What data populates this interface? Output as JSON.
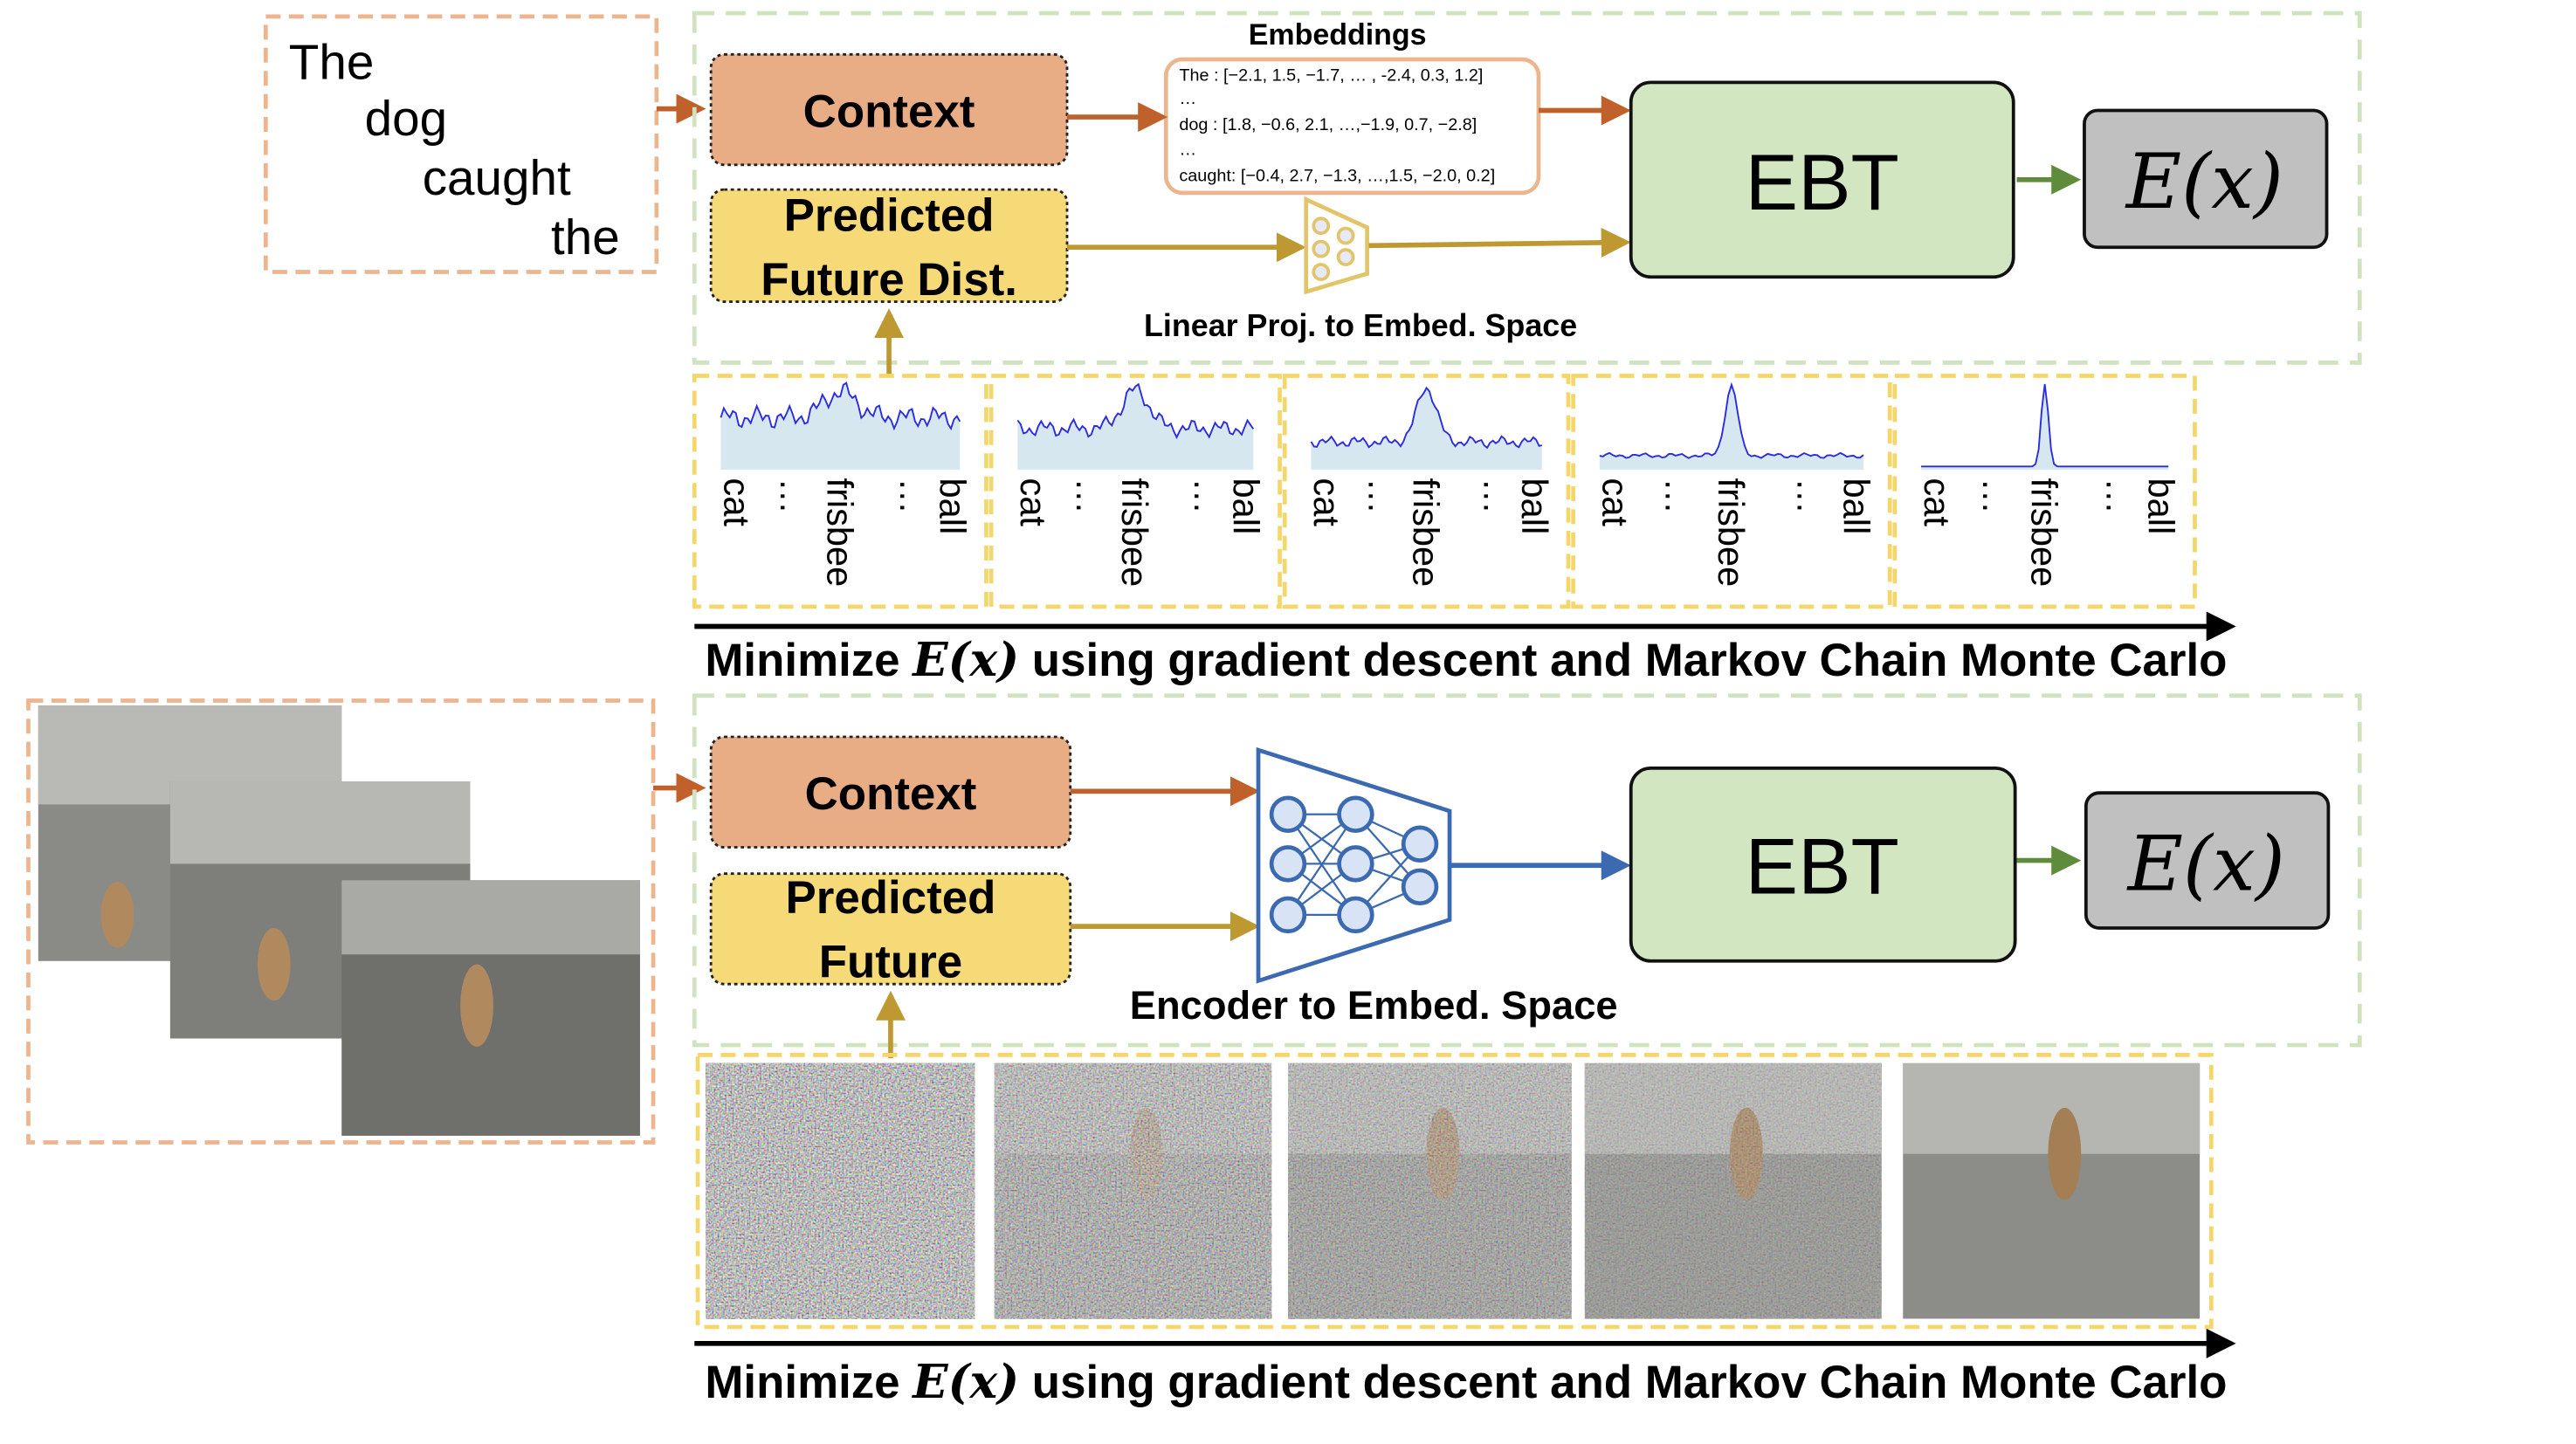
{
  "top": {
    "input_words": [
      "The",
      "dog",
      "caught",
      "the"
    ],
    "context_label": "Context",
    "predicted_label_lines": [
      "Predicted",
      "Future Dist."
    ],
    "embeddings_title": "Embeddings",
    "embeddings_lines": [
      "The : [−2.1, 1.5, −1.7, … , -2.4, 0.3, 1.2]",
      "…",
      "dog : [1.8, −0.6, 2.1, …,−1.9, 0.7, −2.8]",
      "…",
      "caught: [−0.4, 2.7, −1.3, …,1.5, −2.0, 0.2]"
    ],
    "projection_label": "Linear Proj. to Embed. Space",
    "ebt_label": "EBT",
    "energy_label": "E(x)",
    "distribution_axis_labels": [
      "cat",
      "…",
      "frisbee",
      "…",
      "ball"
    ],
    "distribution_peak_sharpness": [
      0.1,
      0.3,
      0.55,
      0.8,
      1.0
    ],
    "caption_prefix": "Minimize ",
    "caption_math": "E(x)",
    "caption_suffix": " using gradient descent and Markov Chain Monte Carlo"
  },
  "bottom": {
    "context_label": "Context",
    "predicted_label_lines": [
      "Predicted",
      "Future"
    ],
    "encoder_label": "Encoder to Embed. Space",
    "ebt_label": "EBT",
    "energy_label": "E(x)",
    "frame_noise_levels": [
      1.0,
      0.75,
      0.55,
      0.35,
      0.0
    ],
    "caption_prefix": "Minimize ",
    "caption_math": "E(x)",
    "caption_suffix": " using gradient descent and Markov Chain Monte Carlo"
  },
  "colors": {
    "context_fill": "#E9AD85",
    "predicted_fill": "#F7DA78",
    "ebt_fill": "#D2E6C2",
    "energy_fill": "#C0C0C0",
    "orange_dash": "#EDB58E",
    "green_dash": "#CFE3BE",
    "yellow_dash": "#F5D66A",
    "arrow_orange": "#C0612B",
    "arrow_gold": "#BE9830",
    "arrow_green": "#5E8C3A",
    "encoder_blue": "#3C6AB0",
    "curve_blue": "#2B2BE0",
    "curve_fill": "#D6E7EF"
  }
}
